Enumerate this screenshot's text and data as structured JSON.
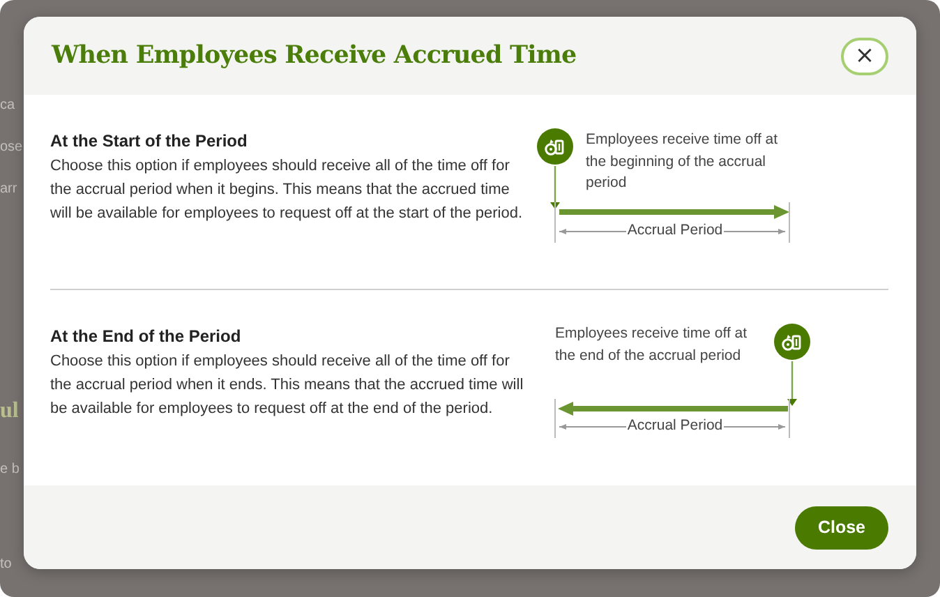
{
  "background": {
    "fragments": [
      {
        "text": "ca",
        "kind": "text"
      },
      {
        "text": "ose",
        "kind": "text"
      },
      {
        "text": "arr",
        "kind": "text"
      },
      {
        "text": "ul",
        "kind": "heading"
      },
      {
        "text": "e b",
        "kind": "text"
      },
      {
        "text": "to",
        "kind": "text"
      }
    ]
  },
  "dialog": {
    "title": "When Employees Receive Accrued Time",
    "close_icon": "×",
    "sections": [
      {
        "heading": "At the Start of the Period",
        "description": "Choose this option if employees should receive all of the time off for the accrual period when it begins. This means that the accrued time will be available for employees to request off at the start of the period.",
        "diagram": {
          "kind": "start",
          "caption": "Employees receive time off at the beginning of the accrual period",
          "period_label": "Accrual Period"
        }
      },
      {
        "heading": "At the End of the Period",
        "description": "Choose this option if employees should receive all of the time off for the accrual period when it ends. This means that the accrued time will be available for employees to request off at the end of the period.",
        "diagram": {
          "kind": "end",
          "caption": "Employees receive time off at the end of the accrual period",
          "period_label": "Accrual Period"
        }
      }
    ],
    "footer": {
      "button": "Close"
    }
  }
}
